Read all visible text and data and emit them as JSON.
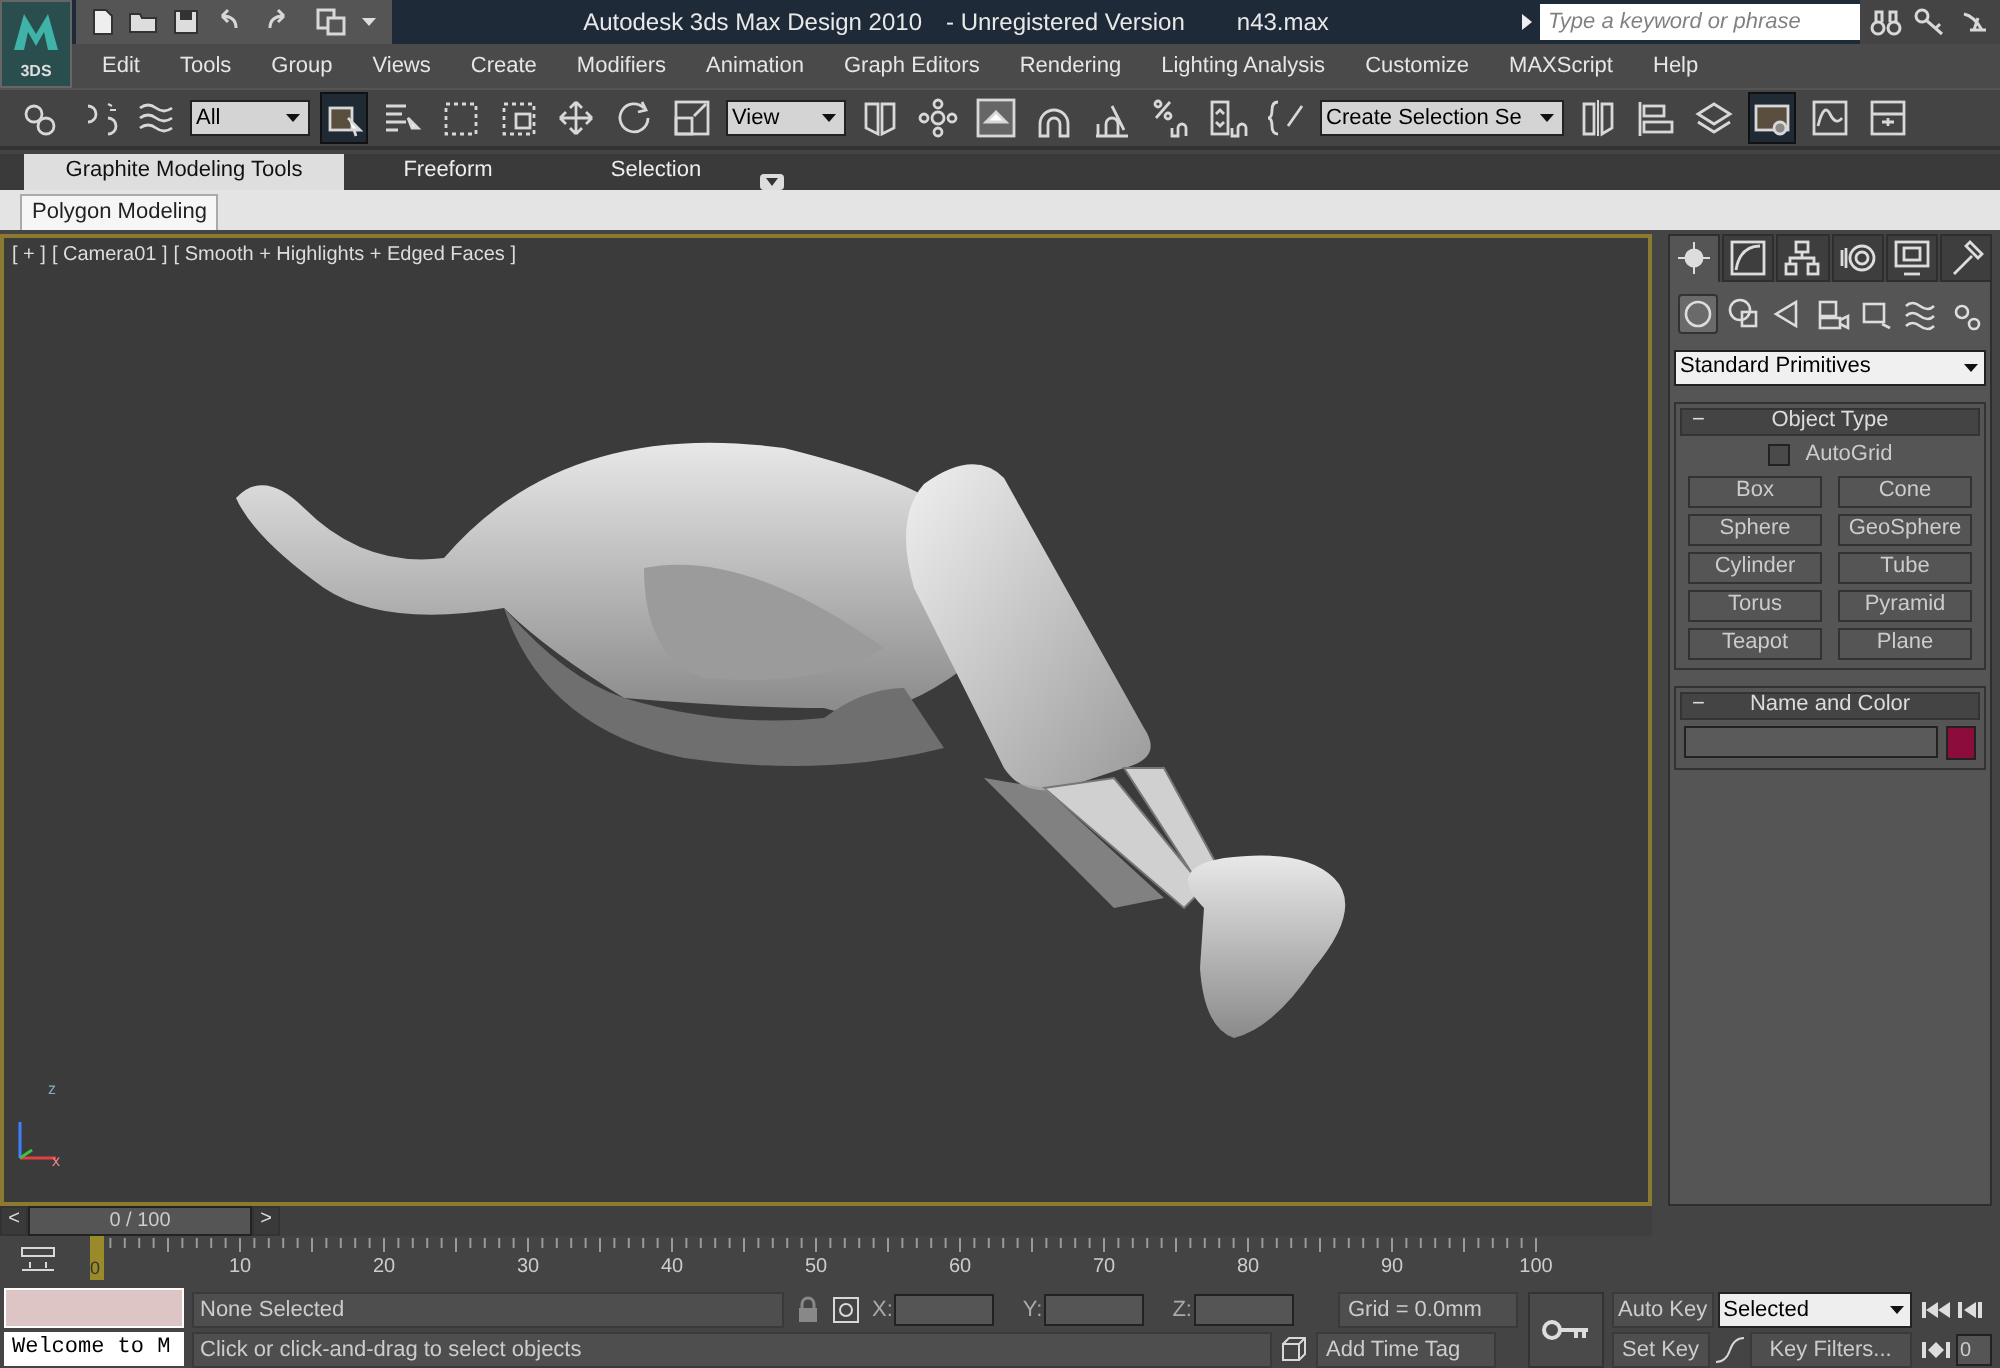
{
  "app_button": {
    "label": "3DS"
  },
  "window": {
    "title": "Autodesk 3ds Max Design 2010",
    "version": "- Unregistered Version",
    "file": "n43.max"
  },
  "search": {
    "placeholder": "Type a keyword or phrase"
  },
  "menu": [
    "Edit",
    "Tools",
    "Group",
    "Views",
    "Create",
    "Modifiers",
    "Animation",
    "Graph Editors",
    "Rendering",
    "Lighting Analysis",
    "Customize",
    "MAXScript",
    "Help"
  ],
  "toolbar": [
    {
      "kind": "icon",
      "selected": false
    },
    {
      "kind": "icon",
      "selected": false
    },
    {
      "kind": "icon",
      "selected": false
    },
    {
      "kind": "dropdown",
      "value": "All"
    },
    {
      "kind": "icon",
      "selected": true
    },
    {
      "kind": "icon",
      "selected": false
    },
    {
      "kind": "icon",
      "selected": false
    },
    {
      "kind": "icon",
      "selected": false
    },
    {
      "kind": "icon",
      "selected": false
    },
    {
      "kind": "icon",
      "selected": false
    },
    {
      "kind": "icon",
      "selected": false
    },
    {
      "kind": "dropdown",
      "value": "View"
    },
    {
      "kind": "icon",
      "selected": false
    },
    {
      "kind": "icon",
      "selected": false
    },
    {
      "kind": "icon",
      "selected": false
    },
    {
      "kind": "icon",
      "selected": false
    },
    {
      "kind": "icon",
      "selected": false
    },
    {
      "kind": "icon",
      "selected": false
    },
    {
      "kind": "icon",
      "selected": false
    },
    {
      "kind": "icon",
      "selected": false
    },
    {
      "kind": "dropdown",
      "value": "Create Selection Se"
    },
    {
      "kind": "icon",
      "selected": false
    },
    {
      "kind": "icon",
      "selected": false
    },
    {
      "kind": "icon",
      "selected": false
    },
    {
      "kind": "icon",
      "selected": true
    },
    {
      "kind": "icon",
      "selected": false
    },
    {
      "kind": "icon",
      "selected": false
    }
  ],
  "ribbon": {
    "tabs": [
      {
        "label": "Graphite Modeling Tools",
        "selected": true
      },
      {
        "label": "Freeform",
        "selected": false
      },
      {
        "label": "Selection",
        "selected": false
      }
    ],
    "panels": [
      {
        "label": "Polygon Modeling",
        "selected": true
      }
    ]
  },
  "viewport": {
    "labels": [
      "[ + ]",
      "[ Camera01 ]",
      "[ Smooth + Highlights + Edged Faces ]"
    ],
    "axis": {
      "z": "z",
      "x": "x"
    }
  },
  "command_panel": {
    "tabs": [
      {
        "selected": true
      },
      {
        "selected": false
      },
      {
        "selected": false
      },
      {
        "selected": false
      },
      {
        "selected": false
      },
      {
        "selected": false
      }
    ],
    "categories": [
      {
        "selected": true
      },
      {
        "selected": false
      },
      {
        "selected": false
      },
      {
        "selected": false
      },
      {
        "selected": false
      },
      {
        "selected": false
      },
      {
        "selected": false
      }
    ],
    "category": "Standard Primitives",
    "object_type": {
      "sign": "−",
      "title": "Object Type",
      "autogrid": {
        "label": "AutoGrid",
        "checked": false
      },
      "buttons": [
        "Box",
        "Cone",
        "Sphere",
        "GeoSphere",
        "Cylinder",
        "Tube",
        "Torus",
        "Pyramid",
        "Teapot",
        "Plane"
      ]
    },
    "name_and_color": {
      "sign": "−",
      "title": "Name and Color",
      "color": "#8c0c3c"
    }
  },
  "time_slider": {
    "prev": "<",
    "position": "0 / 100",
    "next": ">",
    "level": 0
  },
  "track_bar": {
    "frame": "0",
    "ticks": [
      "10",
      "20",
      "30",
      "40",
      "50",
      "60",
      "70",
      "80",
      "90",
      "100"
    ]
  },
  "status": {
    "listener": "Welcome to M",
    "selection": "None Selected",
    "prompt": "Click or click-and-drag to select objects",
    "x_label": "X:",
    "y_label": "Y:",
    "z_label": "Z:",
    "grid": "Grid = 0.0mm",
    "time_tag": "Add Time Tag"
  },
  "animation": {
    "auto_key": "Auto Key",
    "key_mode": "Selected",
    "set_key": "Set Key",
    "key_filters": "Key Filters...",
    "frame": "0"
  }
}
